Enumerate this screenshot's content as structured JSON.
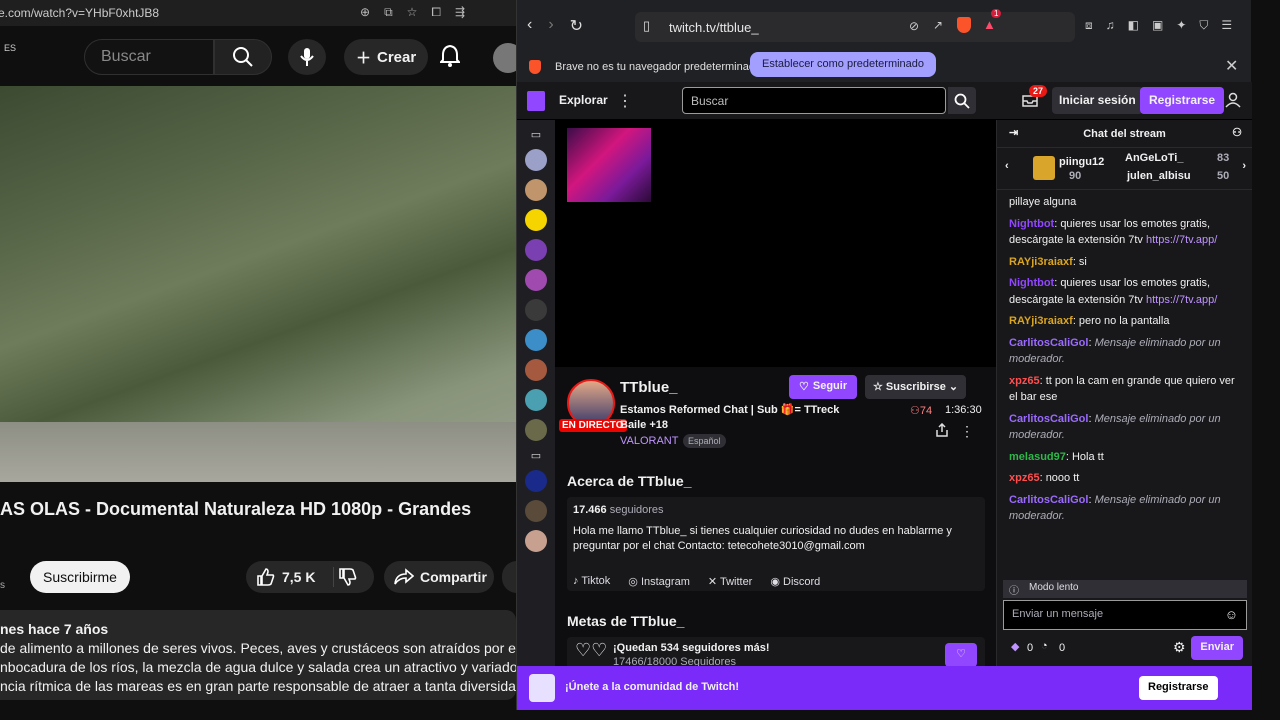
{
  "youtube": {
    "address": "e.com/watch?v=YHbF0xhtJB8",
    "country": "ES",
    "search_placeholder": "Buscar",
    "create_label": "Crear",
    "video_title": "AS OLAS - Documental Naturaleza HD 1080p - Grandes",
    "subscribe_label": "Suscribirme",
    "likes": "7,5 K",
    "share_label": "Compartir",
    "small_s": "s",
    "desc_meta": "nes  hace 7 años",
    "desc_lines": [
      "de alimento a millones de seres vivos. Peces, aves y crustáceos son atraídos por estos",
      "nbocadura de los ríos, la mezcla de agua dulce y salada crea un atractivo y variado cóctel,",
      "ncia rítmica de las mareas es en gran parte responsable de atraer a tanta diversidad  ...más"
    ]
  },
  "brave": {
    "url": "twitch.tv/ttblue_",
    "info_text": "Brave no es tu navegador predeterminado",
    "set_default": "Establecer como predeterminado",
    "shield_badge": "1"
  },
  "twitch": {
    "explore": "Explorar",
    "search_placeholder": "Buscar",
    "notif_count": "27",
    "login": "Iniciar sesión",
    "register": "Registrarse",
    "channel": "TTblue_",
    "live": "EN DIRECTO",
    "stream_title": "Estamos Reformed Chat | Sub 🎁= TTreck Baile +18",
    "game": "VALORANT",
    "lang": "Español",
    "follow": "Seguir",
    "subscribe": "Suscribirse",
    "viewers": "74",
    "uptime": "1:36:30",
    "about_heading": "Acerca de TTblue_",
    "followers_count": "17.466",
    "followers_word": "seguidores",
    "bio": "Hola me llamo TTblue_ si tienes cualquier curiosidad no dudes en hablarme y preguntar por el chat Contacto: tetecohete3010@gmail.com",
    "socials": [
      "Tiktok",
      "Instagram",
      "Twitter",
      "Discord"
    ],
    "goals_heading": "Metas de TTblue_",
    "goal_line1": "¡Quedan 534 seguidores más!",
    "goal_progress": "17466",
    "goal_total": "/18000 Seguidores",
    "banner_text": "¡Únete a la comunidad de Twitch!",
    "banner_button": "Registrarse"
  },
  "chat": {
    "title": "Chat del stream",
    "gifters": [
      {
        "name": "piingu12",
        "count": "90"
      },
      {
        "name": "AnGeLoTi_",
        "count": "83"
      },
      {
        "name": "julen_albisu",
        "count": "50"
      }
    ],
    "messages": [
      {
        "user": "",
        "text": "pillaye alguna",
        "color": "#efeff1"
      },
      {
        "user": "Nightbot",
        "text": ": quieres usar los emotes gratis, descárgate la extensión 7tv ",
        "link": "https://7tv.app/",
        "color": "#9147ff"
      },
      {
        "user": "RAYji3raiaxf",
        "text": ": si",
        "color": "#daa520"
      },
      {
        "user": "Nightbot",
        "text": ": quieres usar los emotes gratis, descárgate la extensión 7tv ",
        "link": "https://7tv.app/",
        "color": "#9147ff"
      },
      {
        "user": "RAYji3raiaxf",
        "text": ": pero no la pantalla",
        "color": "#daa520"
      },
      {
        "user": "CarlitosCaliGol",
        "text": ": ",
        "deleted": "Mensaje eliminado por un moderador.",
        "color": "#9b6bff"
      },
      {
        "user": "xpz65",
        "text": ": tt pon la cam en grande que quiero ver el bar ese",
        "color": "#ff4f4f"
      },
      {
        "user": "CarlitosCaliGol",
        "text": ": ",
        "deleted": "Mensaje eliminado por un moderador.",
        "color": "#9b6bff"
      },
      {
        "user": "melasud97",
        "text": ": Hola tt",
        "color": "#2fb74a"
      },
      {
        "user": "xpz65",
        "text": ": nooo tt",
        "color": "#ff4f4f"
      },
      {
        "user": "CarlitosCaliGol",
        "text": ": ",
        "deleted": "Mensaje eliminado por un moderador.",
        "color": "#9b6bff"
      }
    ],
    "slow_mode": "Modo lento",
    "input_placeholder": "Enviar un mensaje",
    "bits": "0",
    "points": "0",
    "send": "Enviar"
  }
}
